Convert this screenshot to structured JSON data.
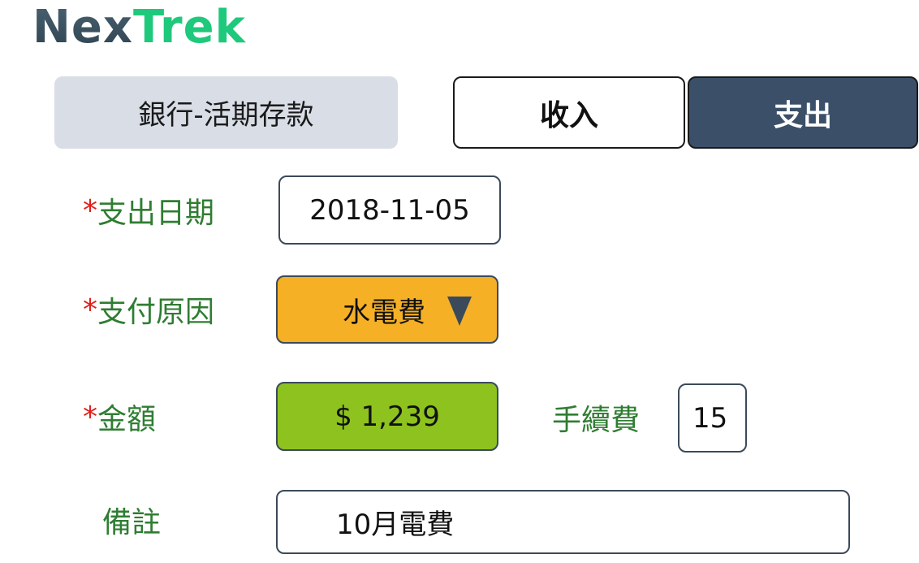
{
  "brand": {
    "logo_part1": "Nex",
    "logo_part2": "Trek",
    "colors": {
      "dark": "#3b5068",
      "green": "#1ec97b"
    }
  },
  "account": {
    "label": "銀行-活期存款"
  },
  "tabs": {
    "income_label": "收入",
    "expense_label": "支出",
    "active": "支出"
  },
  "form": {
    "required_mark": "*",
    "date": {
      "label": "支出日期",
      "value": "2018-11-05"
    },
    "reason": {
      "label": "支付原因",
      "value": "水電費",
      "icon": "triangle-down-icon"
    },
    "amount": {
      "label": "金額",
      "value": "$ 1,239"
    },
    "fee": {
      "label": "手續費",
      "value": "15"
    },
    "note": {
      "label": "備註",
      "value": "10月電費"
    }
  },
  "colors": {
    "label_green": "#2f7d32",
    "required_red": "#e0201b",
    "reason_bg": "#f5b026",
    "amount_bg": "#8dc21f",
    "account_bg": "#d8dde6",
    "active_tab_bg": "#3b5068"
  }
}
